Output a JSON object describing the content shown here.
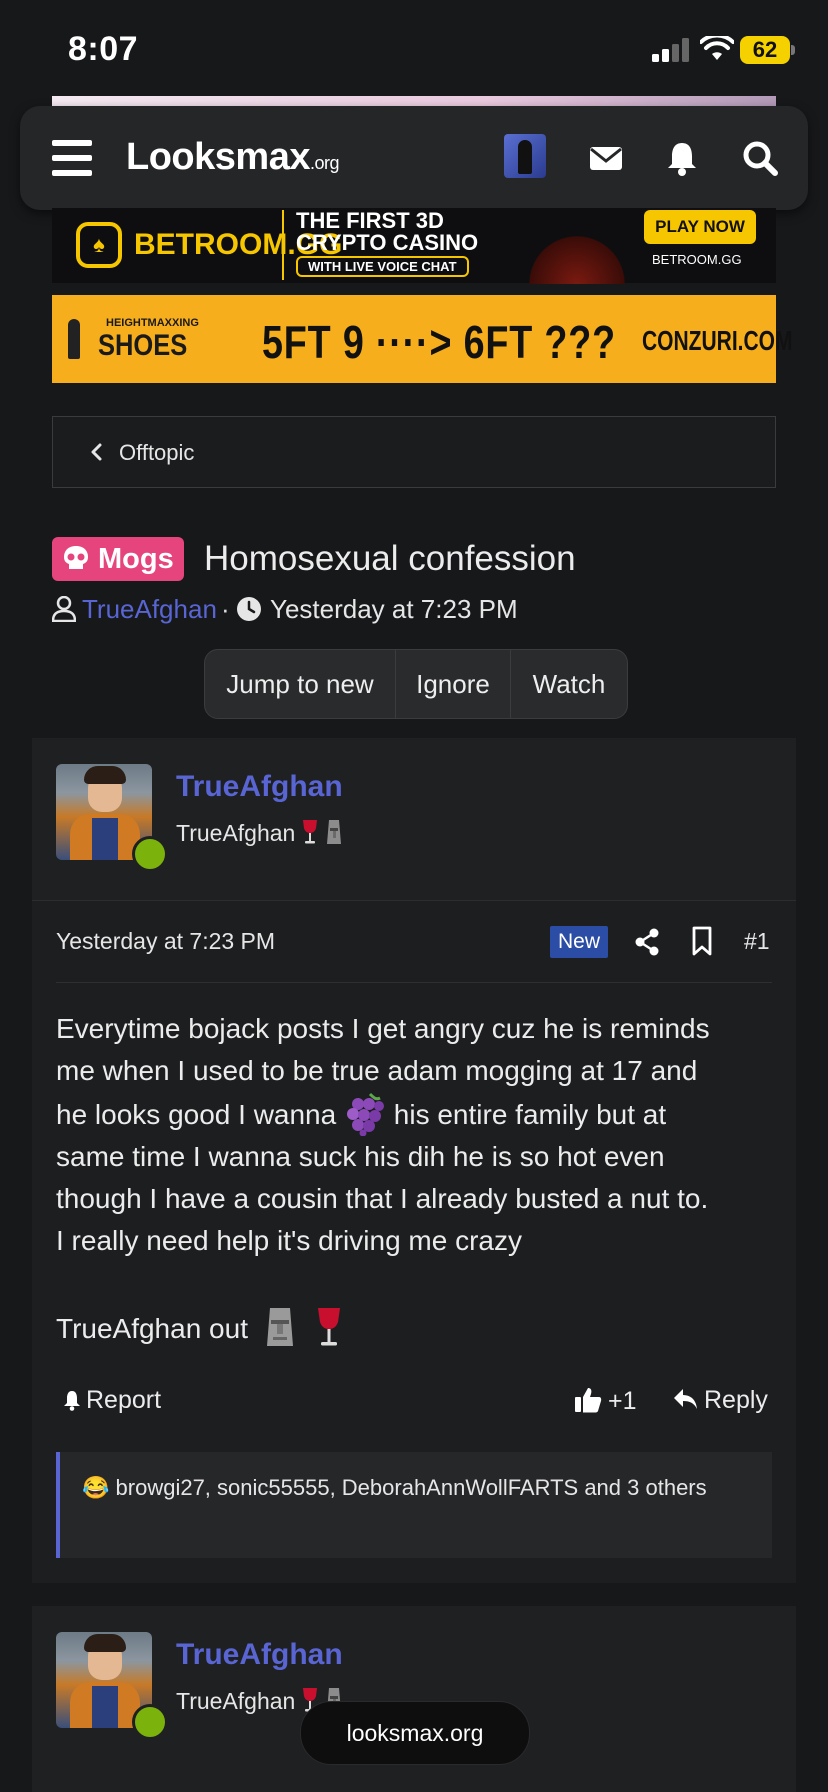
{
  "status_bar": {
    "time": "8:07",
    "battery": "62"
  },
  "header": {
    "logo_main": "Looksmax",
    "logo_suffix": ".org"
  },
  "ads": {
    "betroom": {
      "brand": "BETROOM.GG",
      "headline_line1": "THE FIRST 3D",
      "headline_line2": "CRYPTO CASINO",
      "tag": "WITH LIVE VOICE CHAT",
      "cta": "PLAY NOW",
      "url": "BETROOM.GG"
    },
    "shoes": {
      "small": "HEIGHTMAXXING",
      "brand": "SHOES",
      "headline": "5FT 9 ····> 6FT ???",
      "url": "CONZURI.COM"
    }
  },
  "breadcrumb": {
    "label": "Offtopic"
  },
  "thread": {
    "prefix": "Mogs",
    "title": "Homosexual confession",
    "author": "TrueAfghan",
    "separator": "·",
    "date": "Yesterday at 7:23 PM"
  },
  "actions": {
    "jump": "Jump to new",
    "ignore": "Ignore",
    "watch": "Watch"
  },
  "post": {
    "username": "TrueAfghan",
    "user_title": "TrueAfghan",
    "date": "Yesterday at 7:23 PM",
    "new_badge": "New",
    "number": "#1",
    "body": {
      "l1": "Everytime bojack posts I get angry cuz he is reminds",
      "l2": "me when I used to be true adam mogging at 17 and",
      "l3a": "he looks good I wanna",
      "l3b": "his entire family but at",
      "l4": "same time I wanna suck his dih he is so hot even",
      "l5": "though I have a cousin that I already busted a nut to.",
      "l6": "I really need help it's driving me crazy"
    },
    "signoff": "TrueAfghan out",
    "report": "Report",
    "like_count": "+1",
    "reply": "Reply",
    "reactions": "browgi27, sonic55555, DeborahAnnWollFARTS and 3 others",
    "reaction_emoji": "😂"
  },
  "post2": {
    "username": "TrueAfghan",
    "user_title": "TrueAfghan"
  },
  "footer": {
    "url": "looksmax.org"
  },
  "colors": {
    "accent": "#5865d3",
    "prefix": "#e6447d",
    "online": "#7cb20c",
    "new_badge": "#2c4da5"
  }
}
